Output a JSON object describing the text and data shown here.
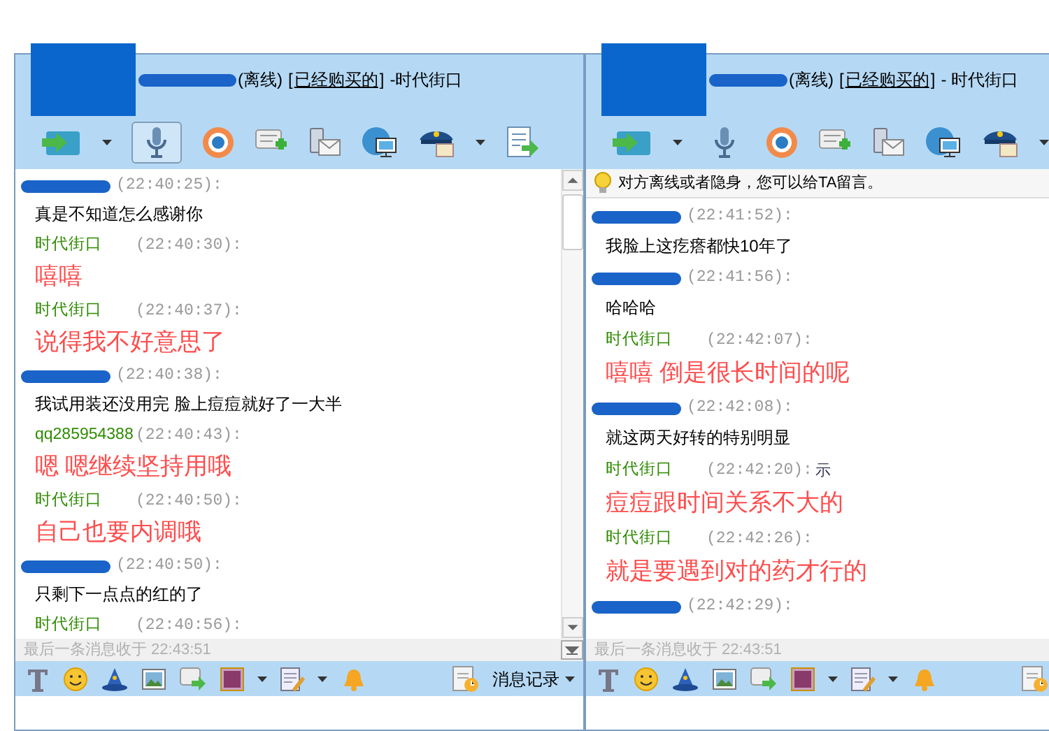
{
  "windows": [
    {
      "title": {
        "status": "(离线)",
        "bracket_open": "[",
        "group_link": "已经购买的",
        "bracket_close": "]",
        "suffix": "-时代街口"
      },
      "voice_selected": true,
      "messages": [
        {
          "kind": "other",
          "time": "(22:40:25):",
          "text": "真是不知道怎么感谢你"
        },
        {
          "kind": "self",
          "sender": "时代街口",
          "time": "(22:40:30):",
          "text": "嘻嘻"
        },
        {
          "kind": "self",
          "sender": "时代街口",
          "time": "(22:40:37):",
          "text": "说得我不好意思了"
        },
        {
          "kind": "other",
          "time": "(22:40:38):",
          "text": "我试用装还没用完  脸上痘痘就好了一大半"
        },
        {
          "kind": "self",
          "sender": "qq285954388",
          "time": "(22:40:43):",
          "text": "嗯  嗯继续坚持用哦"
        },
        {
          "kind": "self",
          "sender": "时代街口",
          "time": "(22:40:50):",
          "text": "自己也要内调哦"
        },
        {
          "kind": "other",
          "time": "(22:40:50):",
          "text": "只剩下一点点的红的了"
        },
        {
          "kind": "self",
          "sender": "时代街口",
          "time": "(22:40:56):"
        }
      ],
      "last_received": "最后一条消息收于  22:43:51",
      "history_label": "消息记录"
    },
    {
      "title": {
        "status": "(离线)",
        "bracket_open": "[",
        "group_link": "已经购买的",
        "bracket_close": "]",
        "suffix": "- 时代街口"
      },
      "voice_selected": false,
      "notice": "对方离线或者隐身，您可以给TA留言。",
      "messages": [
        {
          "kind": "other",
          "time": "(22:41:52):",
          "text": "我脸上这疙瘩都快10年了"
        },
        {
          "kind": "other",
          "time": "(22:41:56):",
          "text": "哈哈哈"
        },
        {
          "kind": "self",
          "sender": "时代街口",
          "time": "(22:42:07):",
          "text": "嘻嘻  倒是很长时间的呢"
        },
        {
          "kind": "other",
          "time": "(22:42:08):",
          "text": "就这两天好转的特别明显"
        },
        {
          "kind": "self",
          "sender": "时代街口",
          "time": "(22:42:20):",
          "note": "示",
          "text": "痘痘跟时间关系不大的"
        },
        {
          "kind": "self",
          "sender": "时代街口",
          "time": "(22:42:26):",
          "text": "就是要遇到对的药才行的"
        },
        {
          "kind": "other",
          "time": "(22:42:29):"
        }
      ],
      "last_received": "最后一条消息收于  22:43:51"
    }
  ]
}
